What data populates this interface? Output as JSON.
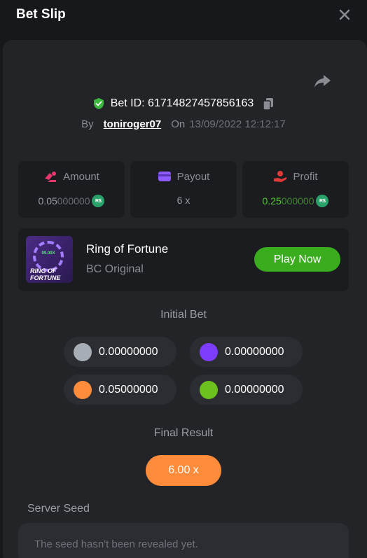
{
  "header": {
    "title": "Bet Slip"
  },
  "bet": {
    "id": "Bet ID: 61714827457856163",
    "by_label": "By",
    "username": "toniroger07",
    "on_label": "On",
    "date": "13/09/2022 12:12:17"
  },
  "stats": {
    "amount": {
      "label": "Amount",
      "value_main": "0.05",
      "value_dim": "000000",
      "color": "#e8366a"
    },
    "payout": {
      "label": "Payout",
      "value": "6 x",
      "color": "#8d5bff"
    },
    "profit": {
      "label": "Profit",
      "value_main": "0.25",
      "value_dim": "000000",
      "color": "#e13a3a",
      "value_color": "#56c936"
    },
    "coin": "R$"
  },
  "game": {
    "name": "Ring of Fortune",
    "provider": "BC Original",
    "play_label": "Play Now",
    "thumb_mult": "99.00X",
    "thumb_title_1": "RING OF",
    "thumb_title_2": "FORTUNE"
  },
  "initial_bet": {
    "label": "Initial Bet",
    "chips": [
      {
        "color": "#a7adb4",
        "value": "0.00000000"
      },
      {
        "color": "#7d3dff",
        "value": "0.00000000"
      },
      {
        "color": "#ff8c3a",
        "value": "0.05000000"
      },
      {
        "color": "#6cc11e",
        "value": "0.00000000"
      }
    ]
  },
  "final_result": {
    "label": "Final Result",
    "value": "6.00 x"
  },
  "server_seed": {
    "label": "Server Seed",
    "text": "The seed hasn't been revealed yet."
  }
}
